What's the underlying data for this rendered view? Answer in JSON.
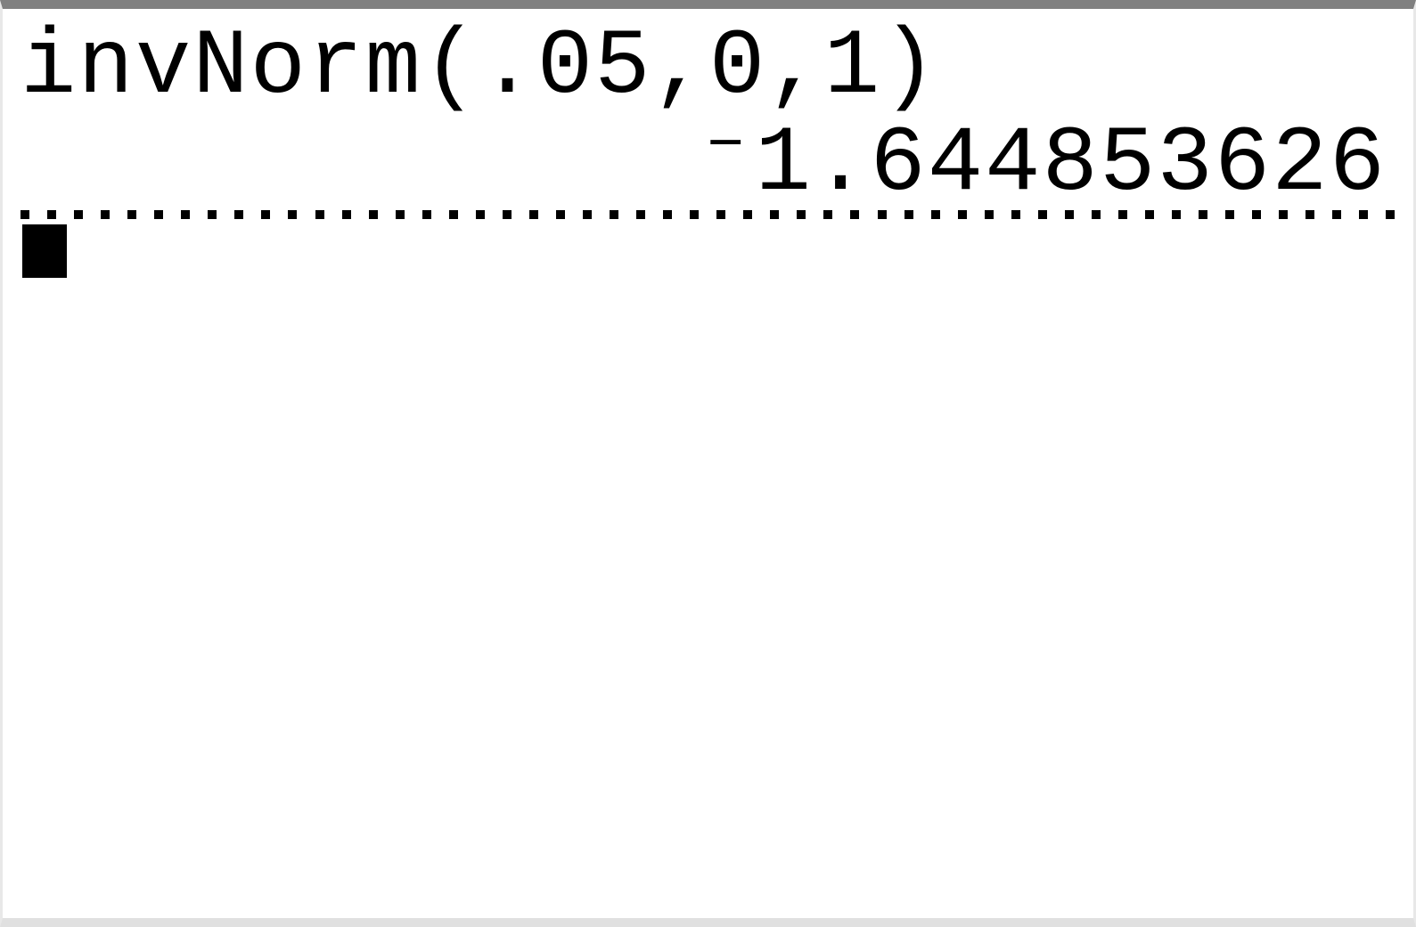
{
  "display": {
    "input_expression": "invNorm(.05,0,1)",
    "result_value": "⁻1.644853626"
  }
}
